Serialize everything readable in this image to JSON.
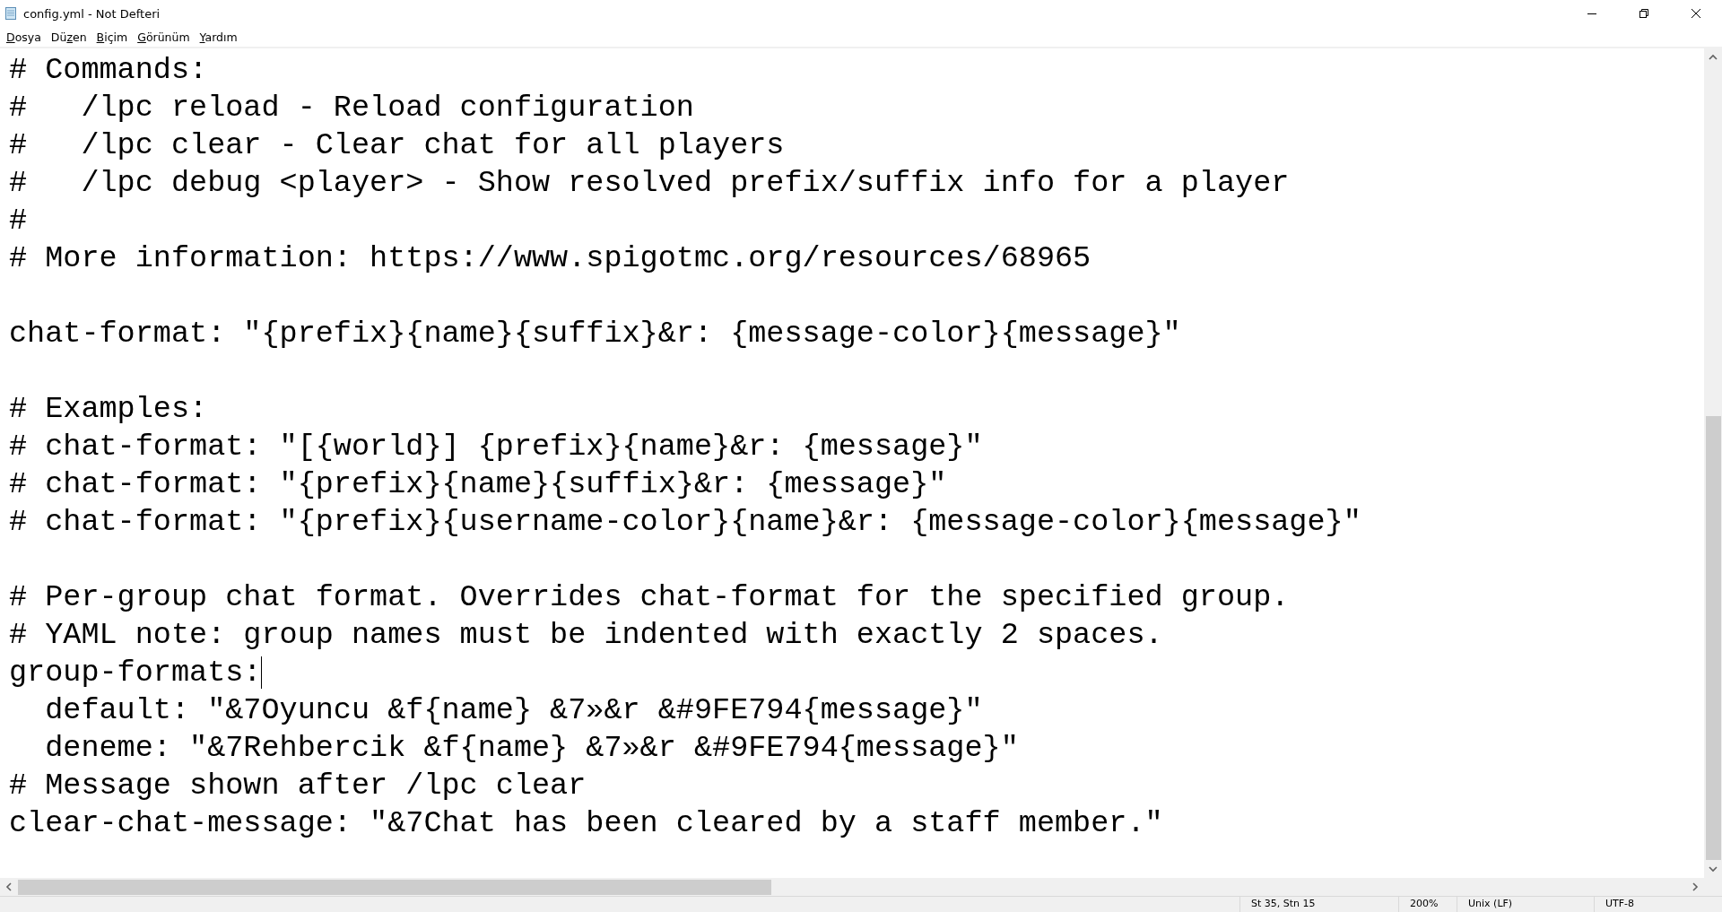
{
  "window": {
    "title": "config.yml - Not Defteri"
  },
  "menu": [
    {
      "parts": [
        {
          "text": "D",
          "underline": true
        },
        {
          "text": "osya",
          "underline": false
        }
      ]
    },
    {
      "parts": [
        {
          "text": "Dü",
          "underline": false
        },
        {
          "text": "z",
          "underline": true
        },
        {
          "text": "en",
          "underline": false
        }
      ]
    },
    {
      "parts": [
        {
          "text": "B",
          "underline": true
        },
        {
          "text": "içim",
          "underline": false
        }
      ]
    },
    {
      "parts": [
        {
          "text": "G",
          "underline": true
        },
        {
          "text": "örünüm",
          "underline": false
        }
      ]
    },
    {
      "parts": [
        {
          "text": "Y",
          "underline": true
        },
        {
          "text": "ardım",
          "underline": false
        }
      ]
    }
  ],
  "editor": {
    "blocks": [
      {
        "lines": [
          {
            "text": "# Commands:",
            "caret": false
          },
          {
            "text": "#   /lpc reload - Reload configuration",
            "caret": false
          },
          {
            "text": "#   /lpc clear - Clear chat for all players",
            "caret": false
          },
          {
            "text": "#   /lpc debug <player> - Show resolved prefix/suffix info for a player",
            "caret": false
          },
          {
            "text": "#",
            "caret": false
          },
          {
            "text": "# More information: https://www.spigotmc.org/resources/68965",
            "caret": false
          }
        ]
      },
      {
        "lines": [
          {
            "text": "chat-format: \"{prefix}{name}{suffix}&r: {message-color}{message}\"",
            "caret": false
          }
        ]
      },
      {
        "lines": [
          {
            "text": "# Examples:",
            "caret": false
          },
          {
            "text": "# chat-format: \"[{world}] {prefix}{name}&r: {message}\"",
            "caret": false
          },
          {
            "text": "# chat-format: \"{prefix}{name}{suffix}&r: {message}\"",
            "caret": false
          },
          {
            "text": "# chat-format: \"{prefix}{username-color}{name}&r: {message-color}{message}\"",
            "caret": false
          }
        ]
      },
      {
        "lines": [
          {
            "text": "# Per-group chat format. Overrides chat-format for the specified group.",
            "caret": false
          },
          {
            "text": "# YAML note: group names must be indented with exactly 2 spaces.",
            "caret": false
          },
          {
            "text": "group-formats:",
            "caret": true
          },
          {
            "text": "  default: \"&7Oyuncu &f{name} &7»&r &#9FE794{message}\"",
            "caret": false
          },
          {
            "text": "  deneme: \"&7Rehbercik &f{name} &7»&r &#9FE794{message}\"",
            "caret": false
          },
          {
            "text": "# Message shown after /lpc clear",
            "caret": false
          },
          {
            "text": "clear-chat-message: \"&7Chat has been cleared by a staff member.\"",
            "caret": false
          }
        ]
      }
    ]
  },
  "status_bar": [
    "St 35, Stn 15",
    "200%",
    "Unix (LF)",
    "UTF-8"
  ]
}
